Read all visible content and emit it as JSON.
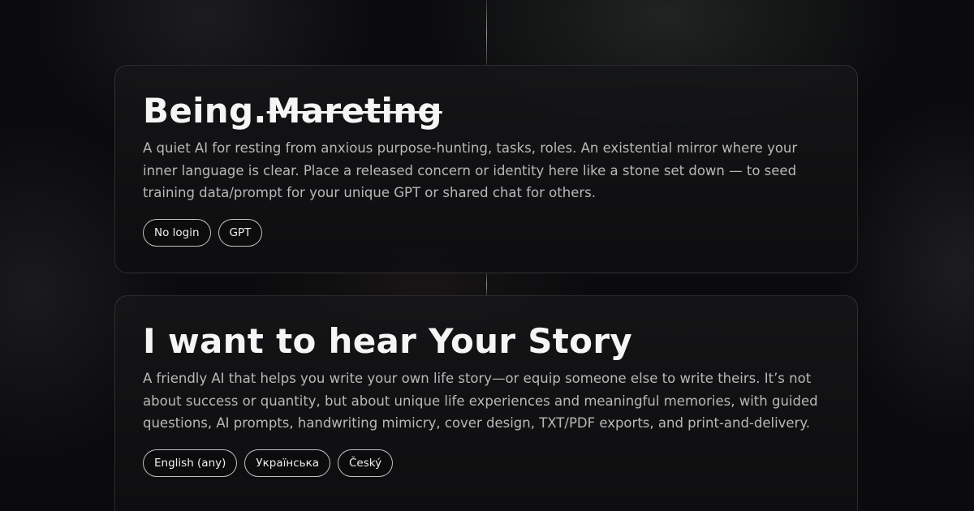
{
  "cards": [
    {
      "title_main": "Being.",
      "title_struck": "Mareting",
      "description": "A quiet AI for resting from anxious purpose-hunting, tasks, roles. An existential mirror where your inner language is clear. Place a released concern or identity here like a stone set down — to seed training data/prompt for your unique GPT or shared chat for others.",
      "tags": [
        "No login",
        "GPT"
      ]
    },
    {
      "title": "I want to hear Your Story",
      "description": "A friendly AI that helps you write your own life story—or equip someone else to write theirs. It’s not about success or quantity, but about unique life experiences and meaningful memories, with guided questions, AI prompts, handwriting mimicry, cover design, TXT/PDF exports, and print-and-delivery.",
      "tags": [
        "English (any)",
        "Українська",
        "Český"
      ]
    }
  ]
}
